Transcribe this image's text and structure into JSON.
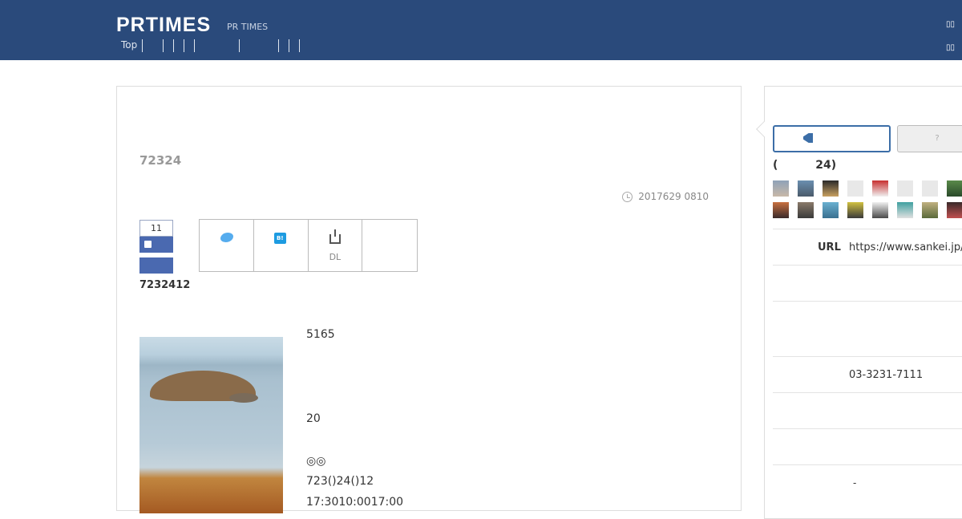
{
  "header": {
    "logo": "PRTIMES",
    "logo_sub": "PR TIMES",
    "nav": [
      "Top",
      "",
      "",
      "",
      "",
      "",
      "",
      "",
      ""
    ]
  },
  "release": {
    "title": "72324",
    "date": "2017629 0810",
    "like_count": "11",
    "download_label": "DL",
    "company_code": "7232412",
    "body": [
      "5165",
      "20",
      "◎◎",
      "723()24()12",
      "17:3010:0017:00"
    ]
  },
  "sidebar": {
    "question_button": "?",
    "followers_label": "(",
    "followers_count": "24)",
    "url_label": "URL",
    "url_value": "https://www.sankei.jp/",
    "tel": "03-3231-7111",
    "dash": "-"
  },
  "colors": {
    "header_bg": "#2a4a7b",
    "accent": "#3c6ea7",
    "facebook": "#4a69b0",
    "twitter": "#55acee",
    "hatena": "#1d9be1"
  },
  "icons": [
    "clock-icon",
    "like-icon",
    "twitter-icon",
    "hatena-bookmark-icon",
    "download-icon",
    "megaphone-icon"
  ]
}
